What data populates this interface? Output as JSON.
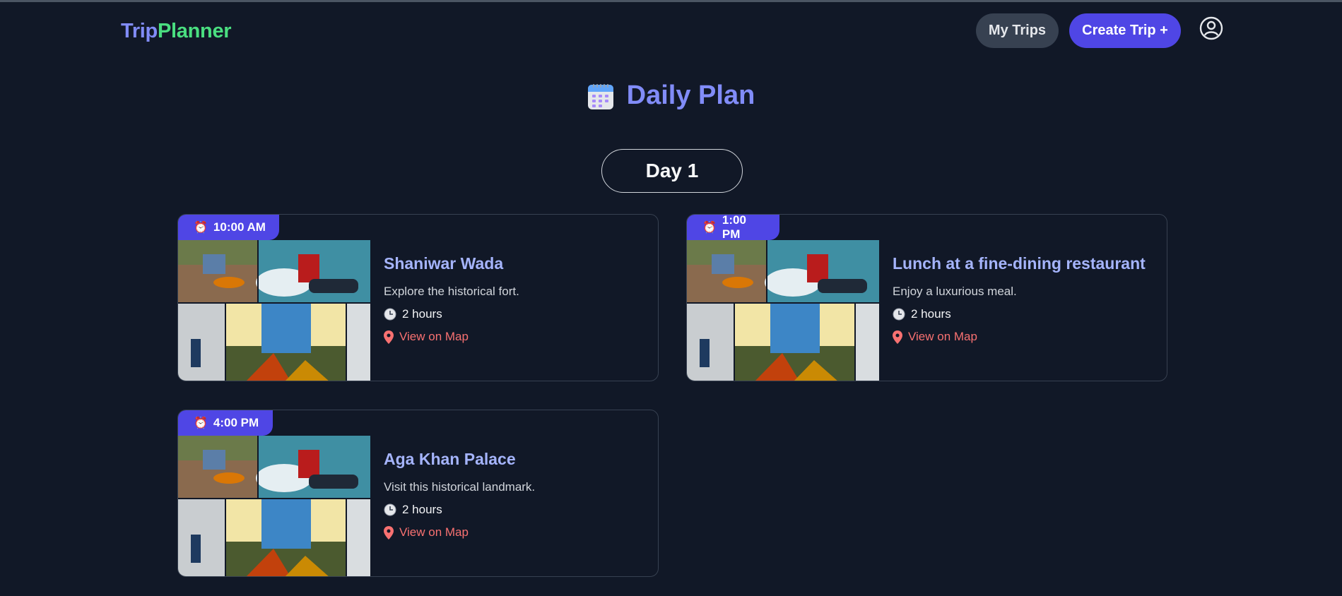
{
  "app": {
    "logo_part1": "Trip",
    "logo_part2": "Planner"
  },
  "nav": {
    "my_trips": "My Trips",
    "create_trip": "Create Trip +"
  },
  "page": {
    "title": "Daily Plan",
    "day_label": "Day 1"
  },
  "activities": [
    {
      "time": "10:00 AM",
      "title": "Shaniwar Wada",
      "description": "Explore the historical fort.",
      "duration": "2 hours",
      "map_link": "View on Map"
    },
    {
      "time": "1:00 PM",
      "title": "Lunch at a fine-dining restaurant",
      "description": "Enjoy a luxurious meal.",
      "duration": "2 hours",
      "map_link": "View on Map"
    },
    {
      "time": "4:00 PM",
      "title": "Aga Khan Palace",
      "description": "Visit this historical landmark.",
      "duration": "2 hours",
      "map_link": "View on Map"
    }
  ],
  "colors": {
    "background": "#111827",
    "accent": "#4f46e5",
    "logo_trip": "#818cf8",
    "logo_planner": "#4ade80",
    "title": "#818cf8",
    "link": "#f87171"
  },
  "icons": [
    "user-circle-icon",
    "calendar-icon",
    "alarm-clock-icon",
    "clock-icon",
    "map-pin-icon"
  ]
}
